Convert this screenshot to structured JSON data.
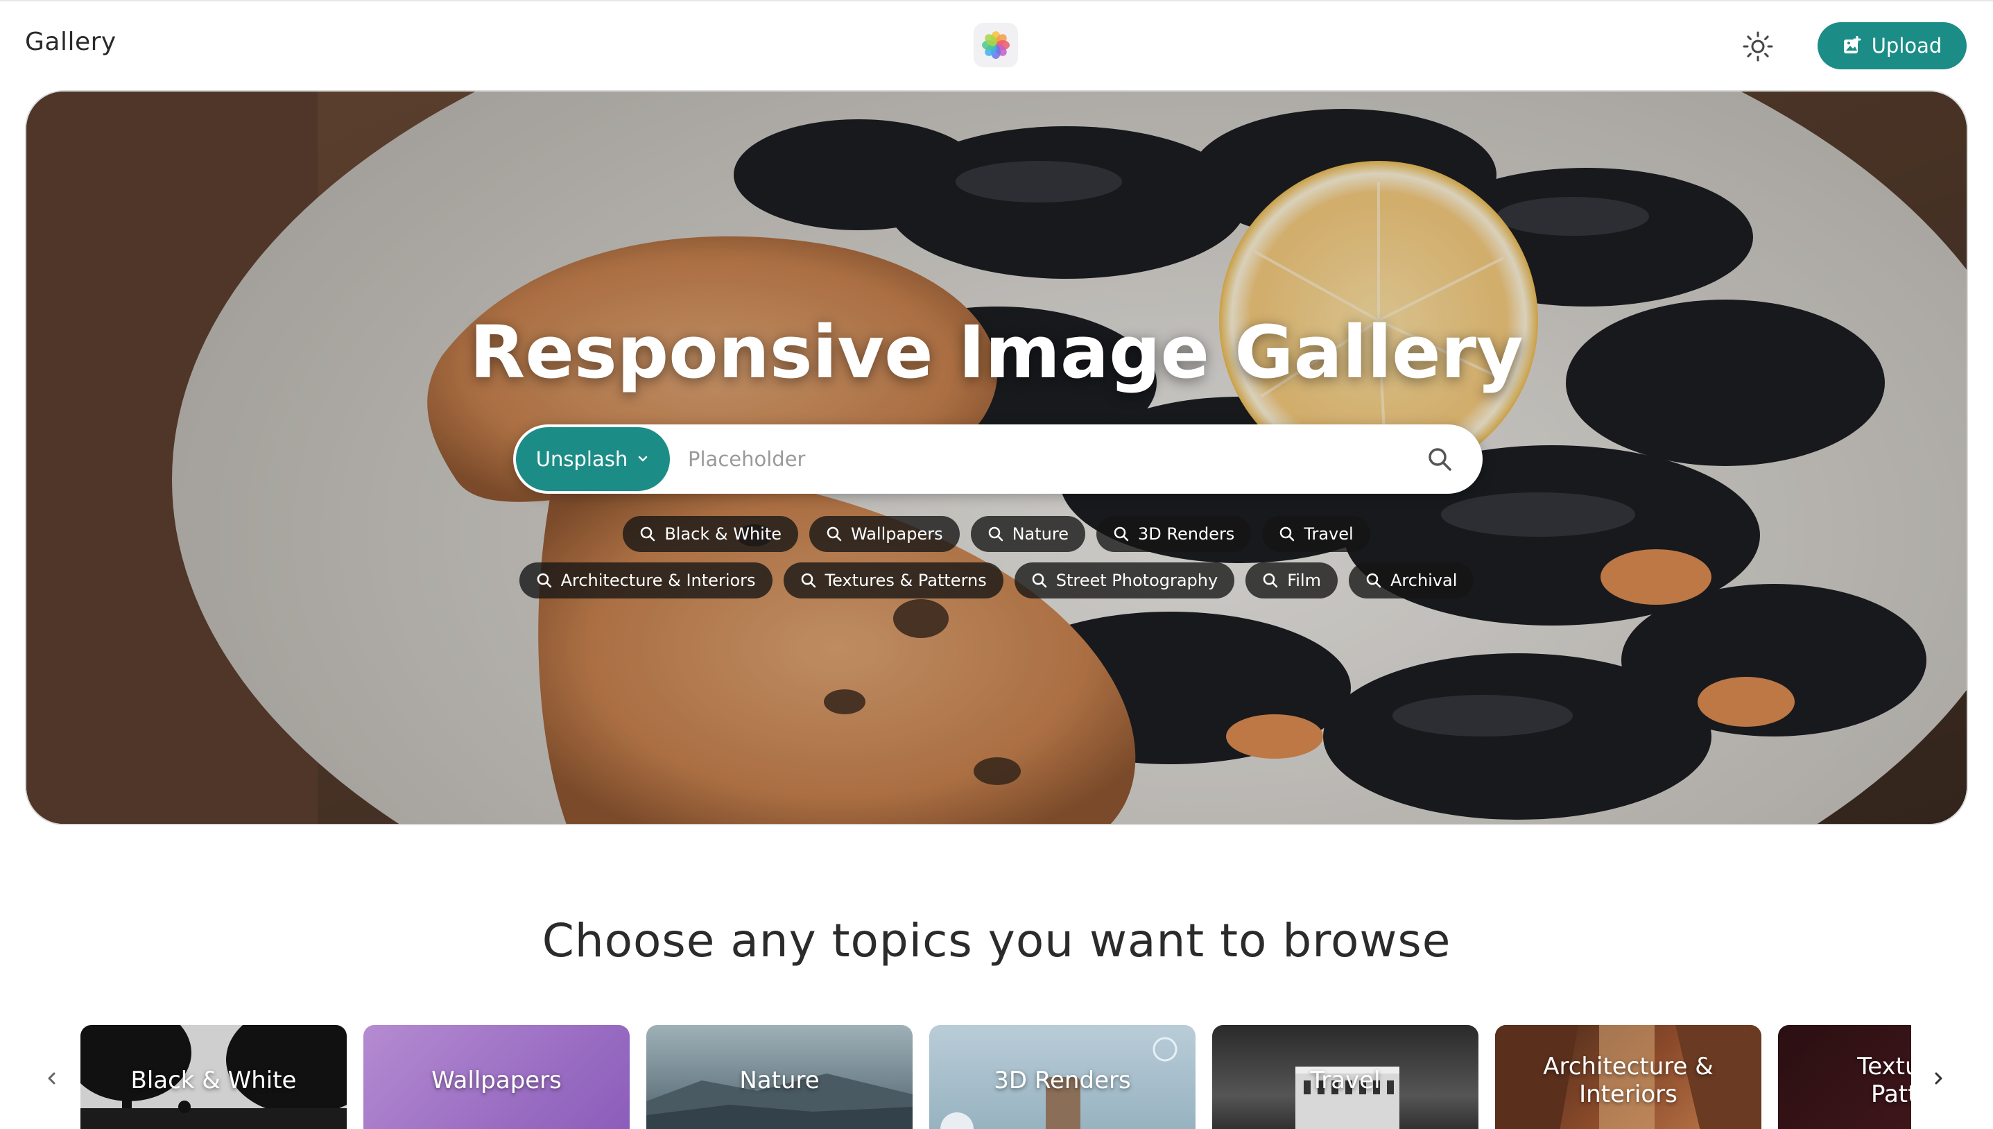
{
  "header": {
    "app_title": "Gallery",
    "upload_label": "Upload",
    "accent_color": "#1c8d86"
  },
  "hero": {
    "title": "Responsive Image Gallery",
    "source_label": "Unsplash",
    "search_placeholder": "Placeholder",
    "chips_row1": [
      "Black & White",
      "Wallpapers",
      "Nature",
      "3D Renders",
      "Travel"
    ],
    "chips_row2": [
      "Architecture & Interiors",
      "Textures & Patterns",
      "Street Photography",
      "Film",
      "Archival"
    ]
  },
  "topics": {
    "heading": "Choose any topics you want to browse",
    "cards": [
      {
        "label": "Black & White"
      },
      {
        "label": "Wallpapers"
      },
      {
        "label": "Nature"
      },
      {
        "label": "3D Renders"
      },
      {
        "label": "Travel"
      },
      {
        "label": "Architecture & Interiors"
      },
      {
        "label": "Textures & Patterns"
      }
    ]
  },
  "icons": [
    "sun-icon",
    "image-plus-icon",
    "chevron-down-icon",
    "search-icon",
    "chevron-left-icon",
    "chevron-right-icon",
    "flower-logo-icon"
  ]
}
